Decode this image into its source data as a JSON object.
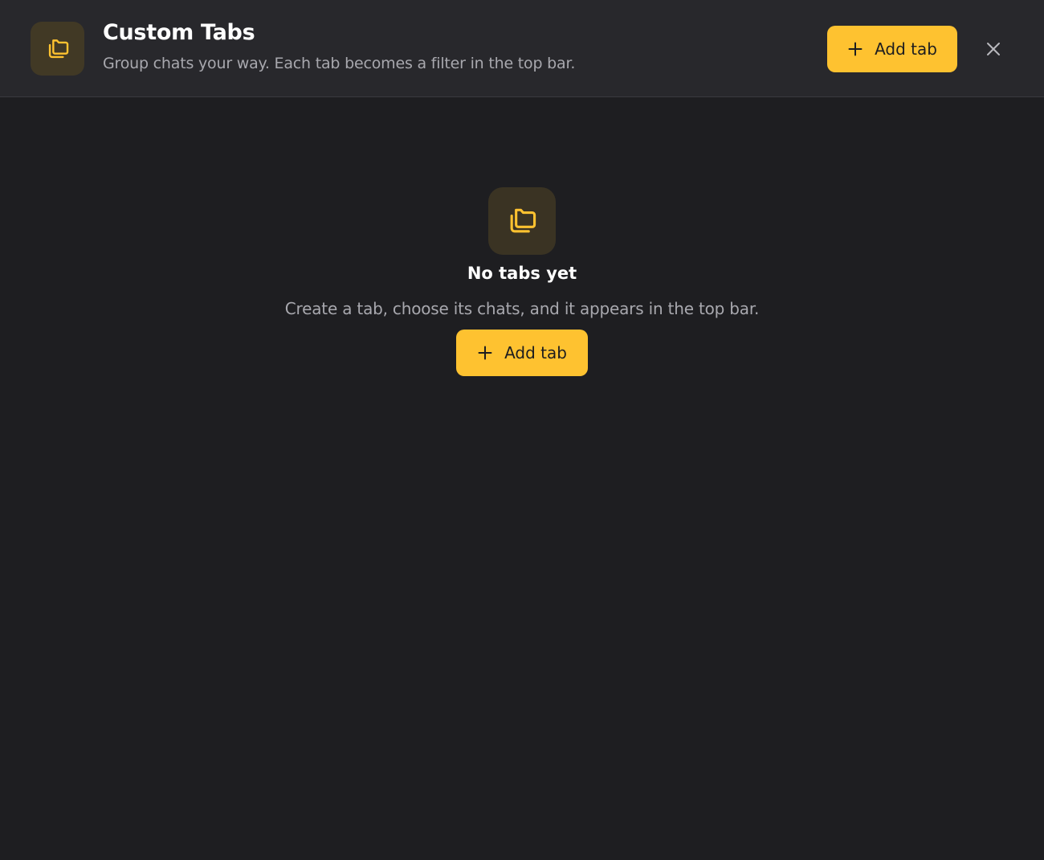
{
  "colors": {
    "accent": "#fec230",
    "background": "#1e1e21",
    "header_background": "#28282c",
    "muted_text": "#a8a8ae",
    "icon_tile": "#413925"
  },
  "header": {
    "icon": "folders-icon",
    "title": "Custom Tabs",
    "subtitle": "Group chats your way. Each tab becomes a filter in the top bar.",
    "add_button_label": "Add tab",
    "add_button_icon": "plus-icon",
    "close_icon": "close-icon"
  },
  "empty_state": {
    "icon": "folders-icon",
    "title": "No tabs yet",
    "description": "Create a tab, choose its chats, and it appears in the top bar.",
    "add_button_label": "Add tab",
    "add_button_icon": "plus-icon"
  }
}
